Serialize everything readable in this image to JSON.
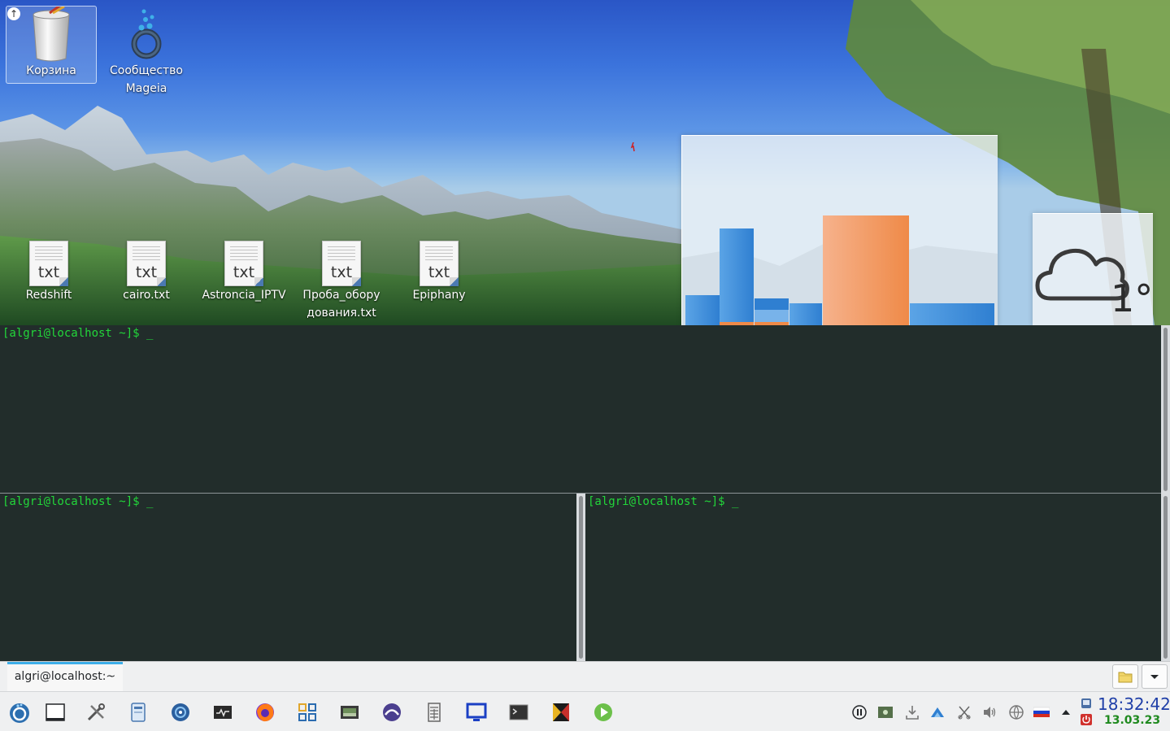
{
  "desktop": {
    "icons": [
      {
        "label": "Корзина",
        "icon": "trash-icon"
      },
      {
        "label": "Сообщество Mageia",
        "icon": "mageia-community-icon"
      },
      {
        "label": "Redshift",
        "icon": "text-file-icon"
      },
      {
        "label": "cairo.txt",
        "icon": "text-file-icon"
      },
      {
        "label": "Astroncia_IPTV",
        "icon": "text-file-icon"
      },
      {
        "label": "Проба_оборудования.txt",
        "icon": "text-file-icon"
      },
      {
        "label": "Epiphany",
        "icon": "text-file-icon"
      }
    ],
    "file_ext_badge": "txt",
    "weather": {
      "temperature": "1°",
      "icon": "cloud-icon"
    }
  },
  "terminal": {
    "panes": [
      {
        "prompt": "[algri@localhost ~]$ _"
      },
      {
        "prompt": "[algri@localhost ~]$ _"
      },
      {
        "prompt": "[algri@localhost ~]$ _"
      }
    ],
    "text_color": "#22d63a",
    "background": "#222d2b",
    "tab": {
      "label": "algri@localhost:~"
    }
  },
  "taskbar": {
    "launchers": [
      "application-menu-icon",
      "show-desktop-icon",
      "system-settings-icon",
      "file-manager-icon",
      "disk-utility-icon",
      "system-monitor-icon",
      "firefox-icon",
      "app-grid-icon",
      "gpu-monitor-icon",
      "software-center-icon",
      "calculator-icon",
      "remote-desktop-icon",
      "terminal-icon",
      "color-picker-icon",
      "media-player-icon"
    ],
    "tray": [
      "pause-icon",
      "screenshot-icon",
      "updates-icon",
      "network-manager-icon",
      "clipboard-icon",
      "volume-icon",
      "vpn-icon",
      "keyboard-layout-ru-icon",
      "tray-expand-icon",
      "lock-screen-icon",
      "power-icon"
    ],
    "clock": {
      "time": "18:32:42",
      "date": "13.03.23"
    }
  }
}
